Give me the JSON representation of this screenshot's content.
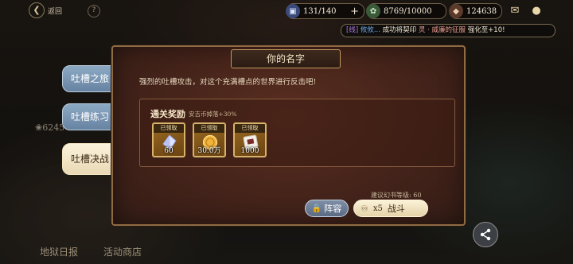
{
  "header": {
    "back_label": "返回",
    "help_icon": "question-icon",
    "stamina": "131/140",
    "coins": "8769/10000",
    "gems": "124638",
    "mail_icon": "chat-bubble-icon",
    "location_icon": "map-pin-icon"
  },
  "marquee": {
    "tag": "[线]",
    "player": "攸攸...",
    "prefix": "成功将契印",
    "item": "灵 · 威廉的征服",
    "suffix": "强化至+10!"
  },
  "tabs": [
    {
      "label": "吐槽之旅"
    },
    {
      "label": "吐槽练习"
    },
    {
      "label": "吐槽决战",
      "active": true
    }
  ],
  "background": {
    "score": "6245",
    "bottom_left": "地狱日报",
    "bottom_mid": "活动商店"
  },
  "panel": {
    "title": "你的名字",
    "description": "强烈的吐槽攻击，对这个充满槽点的世界进行反击吧!",
    "reward_title": "通关奖励",
    "reward_bonus": "安吉币掉落+30%",
    "rewards": [
      {
        "name": "crystal-item",
        "claimed": "已领取",
        "qty": "60"
      },
      {
        "name": "coin-item",
        "claimed": "已领取",
        "qty": "30.0万"
      },
      {
        "name": "ticket-item",
        "claimed": "已领取",
        "qty": "1000"
      }
    ],
    "suggest_level": "建议幻书等级: 60",
    "lineup_label": "阵容",
    "battle_count": "x5",
    "battle_label": "战斗"
  },
  "colors": {
    "panel_bg": "#44231a",
    "panel_border": "#8f6b44",
    "tab_blue": "#7a96b4",
    "tab_active": "#f3e7c8",
    "reward_border": "#d6b26a"
  }
}
